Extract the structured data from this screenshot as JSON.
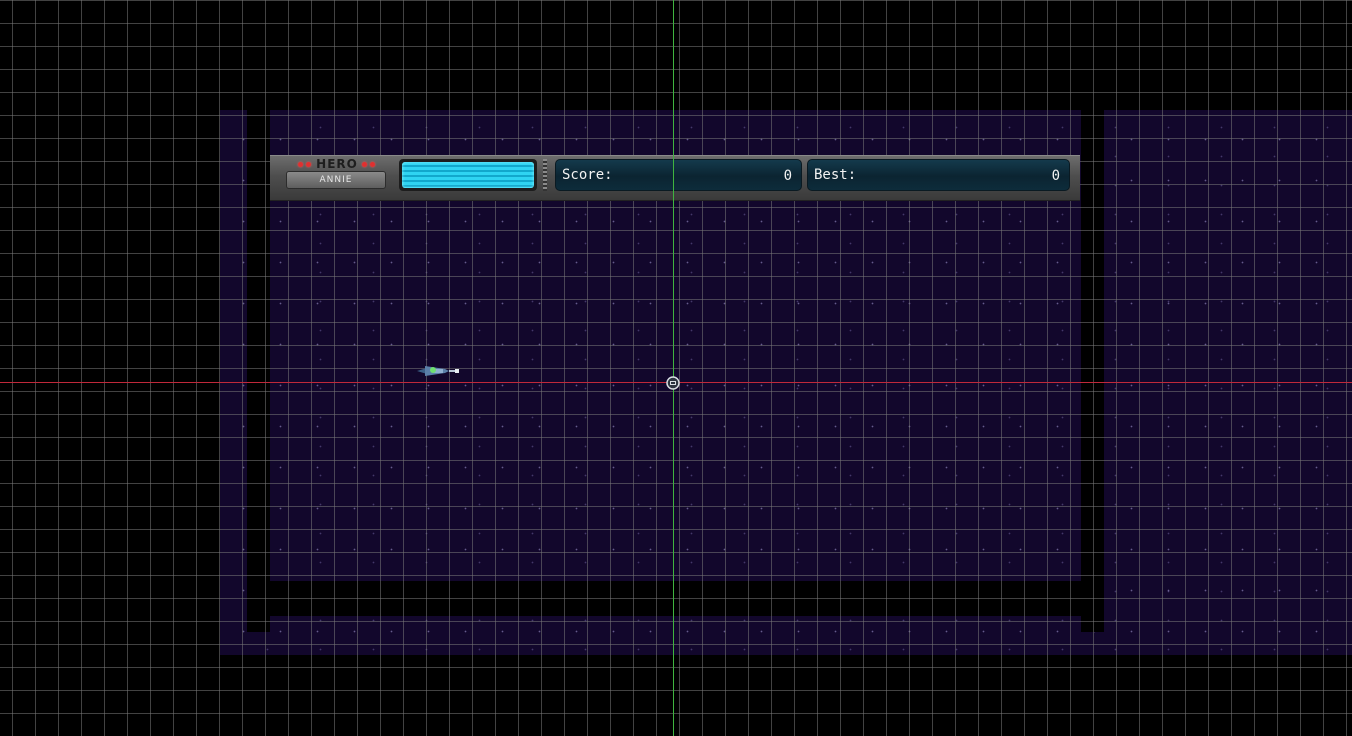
{
  "hud": {
    "hero_title": "HERO",
    "hero_name": "ANNIE",
    "energy_level": 1.0,
    "score_label": "Score:",
    "score_value": "0",
    "best_label": "Best:",
    "best_value": "0"
  },
  "colors": {
    "space": "#12072c",
    "energy": "#2fd4f2",
    "axis_x": "#c0283a",
    "axis_y": "#3fb43f",
    "led": "#e03030"
  },
  "icons": {
    "player": "spaceship-icon",
    "origin": "origin-marker-icon"
  }
}
